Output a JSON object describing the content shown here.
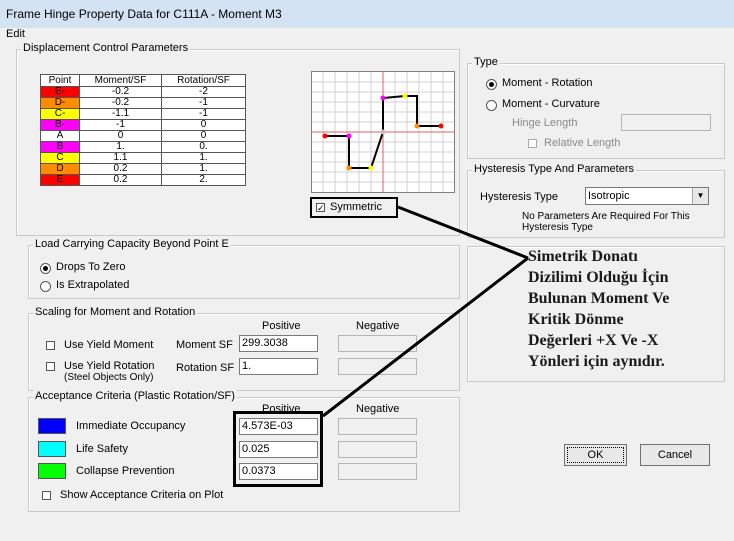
{
  "window": {
    "title": "Frame Hinge Property Data for C111A - Moment M3"
  },
  "menu": {
    "edit": "Edit"
  },
  "displacement": {
    "group_label": "Displacement Control Parameters",
    "headers": [
      "Point",
      "Moment/SF",
      "Rotation/SF"
    ],
    "rows": [
      {
        "point": "E-",
        "moment": "-0.2",
        "rotation": "-2",
        "color": "#ff0000"
      },
      {
        "point": "D-",
        "moment": "-0.2",
        "rotation": "-1",
        "color": "#ff8c00"
      },
      {
        "point": "C-",
        "moment": "-1.1",
        "rotation": "-1",
        "color": "#ffff00"
      },
      {
        "point": "B-",
        "moment": "-1",
        "rotation": "0",
        "color": "#ff00ff"
      },
      {
        "point": "A",
        "moment": "0",
        "rotation": "0",
        "color": "#ffffff"
      },
      {
        "point": "B",
        "moment": "1.",
        "rotation": "0.",
        "color": "#ff00ff"
      },
      {
        "point": "C",
        "moment": "1.1",
        "rotation": "1.",
        "color": "#ffff00"
      },
      {
        "point": "D",
        "moment": "0.2",
        "rotation": "1.",
        "color": "#ff8c00"
      },
      {
        "point": "E",
        "moment": "0.2",
        "rotation": "2.",
        "color": "#ff0000"
      }
    ],
    "symmetric_label": "Symmetric"
  },
  "load_capacity": {
    "group_label": "Load Carrying Capacity Beyond Point E",
    "drops_to_zero": "Drops To Zero",
    "is_extrapolated": "Is Extrapolated"
  },
  "scaling": {
    "group_label": "Scaling for Moment and Rotation",
    "positive": "Positive",
    "negative": "Negative",
    "use_yield_moment": "Use Yield Moment",
    "moment_sf_label": "Moment SF",
    "moment_sf_value": "299.3038",
    "use_yield_rotation": "Use Yield Rotation",
    "steel_only": "(Steel Objects Only)",
    "rotation_sf_label": "Rotation SF",
    "rotation_sf_value": "1."
  },
  "acceptance": {
    "group_label": "Acceptance Criteria (Plastic Rotation/SF)",
    "positive": "Positive",
    "negative": "Negative",
    "items": [
      {
        "label": "Immediate Occupancy",
        "value": "4.573E-03",
        "color": "#0000ff"
      },
      {
        "label": "Life Safety",
        "value": "0.025",
        "color": "#00ffff"
      },
      {
        "label": "Collapse Prevention",
        "value": "0.0373",
        "color": "#00ff00"
      }
    ],
    "show_on_plot": "Show Acceptance Criteria on Plot"
  },
  "type": {
    "group_label": "Type",
    "moment_rotation": "Moment - Rotation",
    "moment_curvature": "Moment - Curvature",
    "hinge_length": "Hinge Length",
    "relative_length": "Relative Length"
  },
  "hysteresis": {
    "group_label": "Hysteresis Type And Parameters",
    "type_label": "Hysteresis Type",
    "type_value": "Isotropic",
    "note_line1": "No Parameters Are Required For This",
    "note_line2": "Hysteresis Type"
  },
  "buttons": {
    "ok": "OK",
    "cancel": "Cancel"
  },
  "annotation": {
    "lines": [
      "Simetrik Donatı",
      "Dizilimi Olduğu İçin",
      "Bulunan Moment Ve",
      "Kritik Dönme",
      "Değerleri +X Ve -X",
      "Yönleri için aynıdır."
    ]
  }
}
